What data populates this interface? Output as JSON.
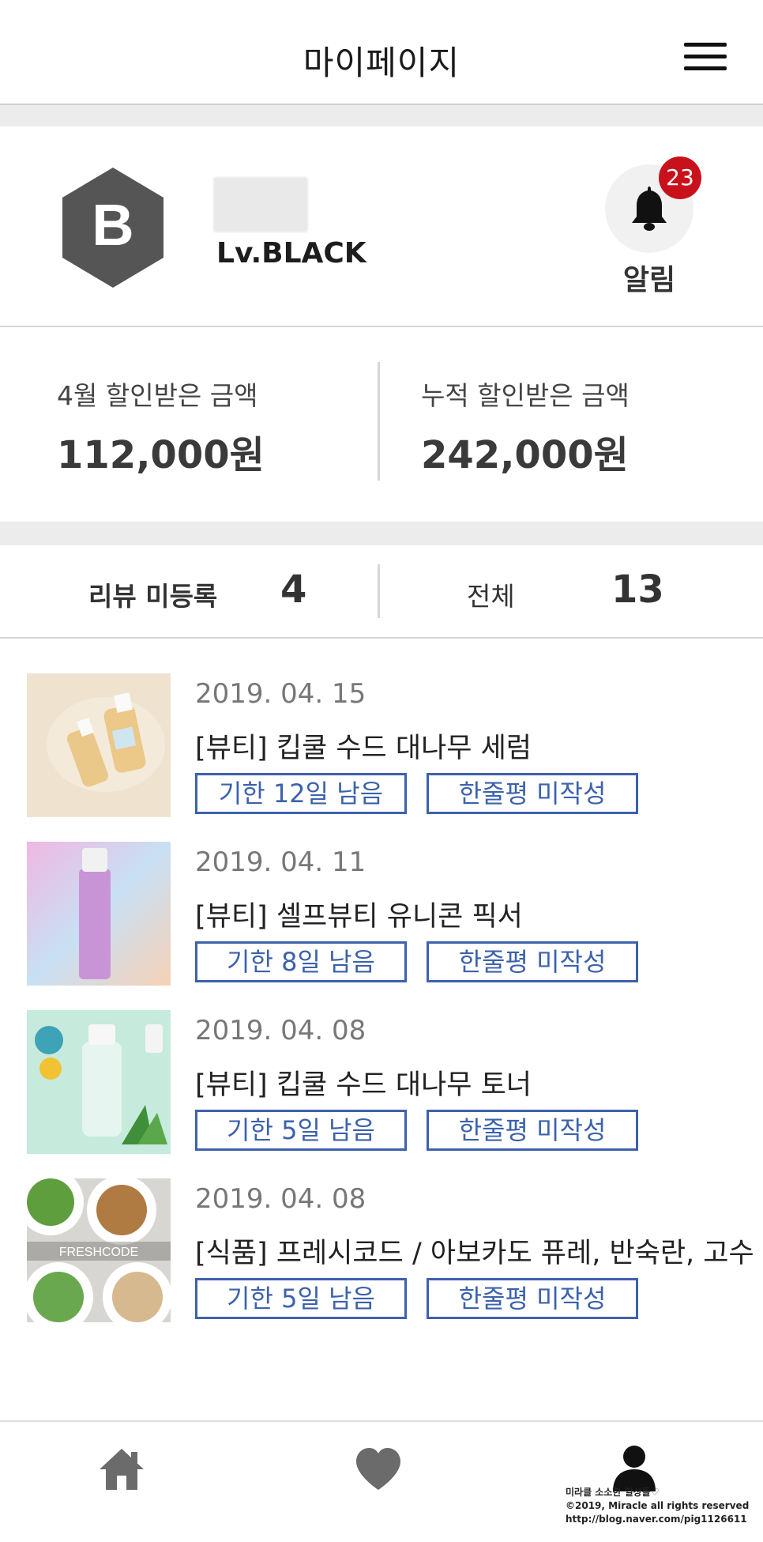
{
  "header": {
    "title": "마이페이지",
    "menu_icon": "hamburger-menu-icon"
  },
  "profile": {
    "badge_letter": "B",
    "level": "Lv.BLACK",
    "badge_color": "#555555",
    "notification": {
      "count": "23",
      "label": "알림",
      "icon": "bell-icon",
      "badge_color": "#c9111b"
    }
  },
  "savings": {
    "month_label": "4월 할인받은 금액",
    "month_value": "112,000원",
    "total_label": "누적 할인받은 금액",
    "total_value": "242,000원"
  },
  "review_tabs": {
    "pending_label": "리뷰 미등록",
    "pending_count": "4",
    "all_label": "전체",
    "all_count": "13"
  },
  "orders": [
    {
      "date": "2019. 04. 15",
      "title": "[뷰티] 킵쿨 수드 대나무 세럼",
      "deadline": "기한 12일 남음",
      "review": "한줄평 미작성"
    },
    {
      "date": "2019. 04. 11",
      "title": "[뷰티] 셀프뷰티 유니콘 픽서",
      "deadline": "기한 8일 남음",
      "review": "한줄평 미작성"
    },
    {
      "date": "2019. 04. 08",
      "title": "[뷰티] 킵쿨 수드 대나무 토너",
      "deadline": "기한 5일 남음",
      "review": "한줄평 미작성"
    },
    {
      "date": "2019. 04. 08",
      "title": "[식품] 프레시코드 / 아보카도 퓨레, 반숙란, 고수 샐러드",
      "deadline": "기한 5일 남음",
      "review": "한줄평 미작성",
      "thumb_text": "FRESHCODE"
    }
  ],
  "bottom_nav": {
    "home_icon": "home-icon",
    "wishlist_icon": "heart-icon",
    "mypage_icon": "person-icon"
  },
  "watermark": {
    "line1": "미라클 소소한 일상들♡",
    "line2": "©2019, Miracle all rights reserved",
    "line3": "http://blog.naver.com/pig1126611"
  },
  "colors": {
    "accent": "#3c62ad",
    "separator": "#ececec"
  }
}
